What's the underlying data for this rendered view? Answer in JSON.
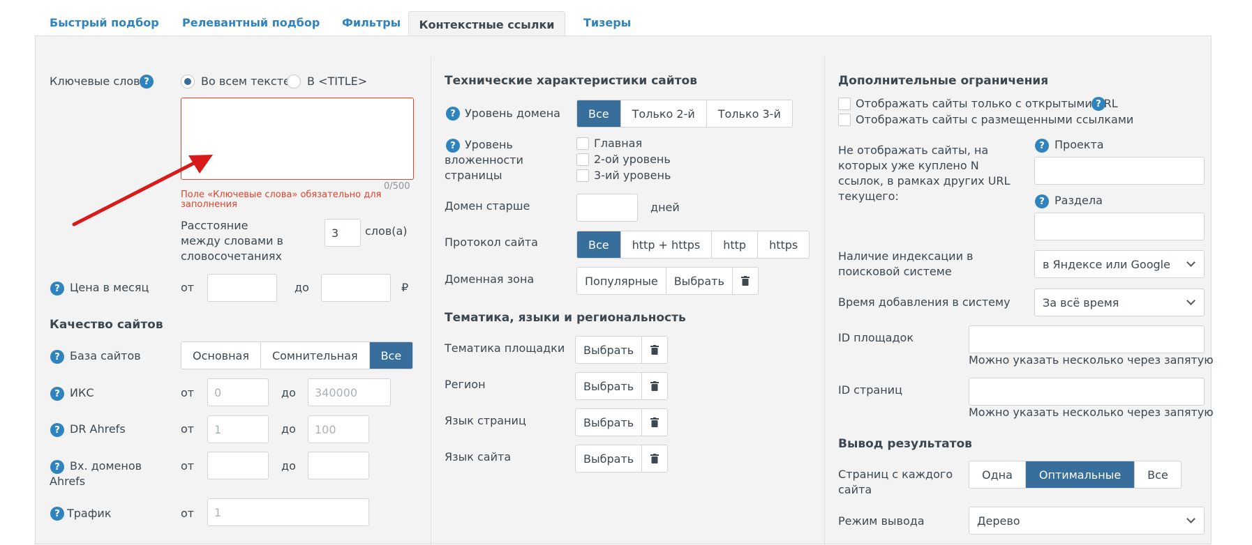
{
  "tabs": [
    {
      "label": "Быстрый подбор"
    },
    {
      "label": "Релевантный подбор"
    },
    {
      "label": "Фильтры"
    },
    {
      "label": "Контекстные ссылки"
    },
    {
      "label": "Тизеры"
    }
  ],
  "left": {
    "keywords_label": "Ключевые слова",
    "radio_all_text": "Во всем тексте",
    "radio_title": "В <TITLE>",
    "keywords_value": "",
    "counter": "0/500",
    "error": "Поле «Ключевые слова» обязательно для заполнения",
    "distance_label": "Расстояние между словами в словосочетаниях",
    "distance_value": "3",
    "distance_unit": "слов(а)",
    "price_label": "Цена в месяц",
    "from": "от",
    "to": "до",
    "currency": "₽",
    "quality_heading": "Качество сайтов",
    "base_label": "База сайтов",
    "base_options": [
      "Основная",
      "Сомнительная",
      "Все"
    ],
    "base_selected": "Все",
    "iks_label": "ИКС",
    "iks_from_ph": "0",
    "iks_to_ph": "340000",
    "dr_label": "DR Ahrefs",
    "dr_from_ph": "1",
    "dr_to_ph": "100",
    "domains_label": "Вх. доменов Ahrefs",
    "traffic_label": "Трафик",
    "traffic_from_ph": "1"
  },
  "middle": {
    "tech_heading": "Технические характеристики сайтов",
    "domain_level_label": "Уровень домена",
    "domain_level_options": [
      "Все",
      "Только 2-й",
      "Только 3-й"
    ],
    "domain_level_selected": "Все",
    "nesting_label": "Уровень вложенности страницы",
    "nesting_options": [
      "Главная",
      "2-ой уровень",
      "3-ий уровень"
    ],
    "older_label": "Домен старше",
    "days": "дней",
    "protocol_label": "Протокол сайта",
    "protocol_options": [
      "Все",
      "http + https",
      "http",
      "https"
    ],
    "protocol_selected": "Все",
    "zone_label": "Доменная зона",
    "zone_popular": "Популярные",
    "choose": "Выбрать",
    "topics_heading": "Тематика, языки и региональность",
    "topic_label": "Тематика площадки",
    "region_label": "Регион",
    "page_lang_label": "Язык страниц",
    "site_lang_label": "Язык сайта"
  },
  "right": {
    "extra_heading": "Дополнительные ограничения",
    "open_url_label": "Отображать сайты только с открытыми URL",
    "placed_links_label": "Отображать сайты с размещенными ссылками",
    "not_show_label": "Не отображать сайты, на которых уже куплено N ссылок, в рамках других URL текущего:",
    "project_label": "Проекта",
    "section_label": "Раздела",
    "indexing_label": "Наличие индексации в поисковой системе",
    "indexing_value": "в Яндексе или Google",
    "added_label": "Время добавления в систему",
    "added_value": "За всё время",
    "platform_ids_label": "ID площадок",
    "platform_ids_hint": "Можно указать несколько через запятую",
    "page_ids_label": "ID страниц",
    "page_ids_hint": "Можно указать несколько через запятую",
    "output_heading": "Вывод результатов",
    "pages_per_site_label": "Страниц с каждого сайта",
    "pages_options": [
      "Одна",
      "Оптимальные",
      "Все"
    ],
    "pages_selected": "Оптимальные",
    "mode_label": "Режим вывода",
    "mode_value": "Дерево"
  },
  "colors": {
    "accent": "#386e9c",
    "link": "#2f84c0",
    "error": "#e0422b",
    "arrow": "#d91a1a"
  }
}
